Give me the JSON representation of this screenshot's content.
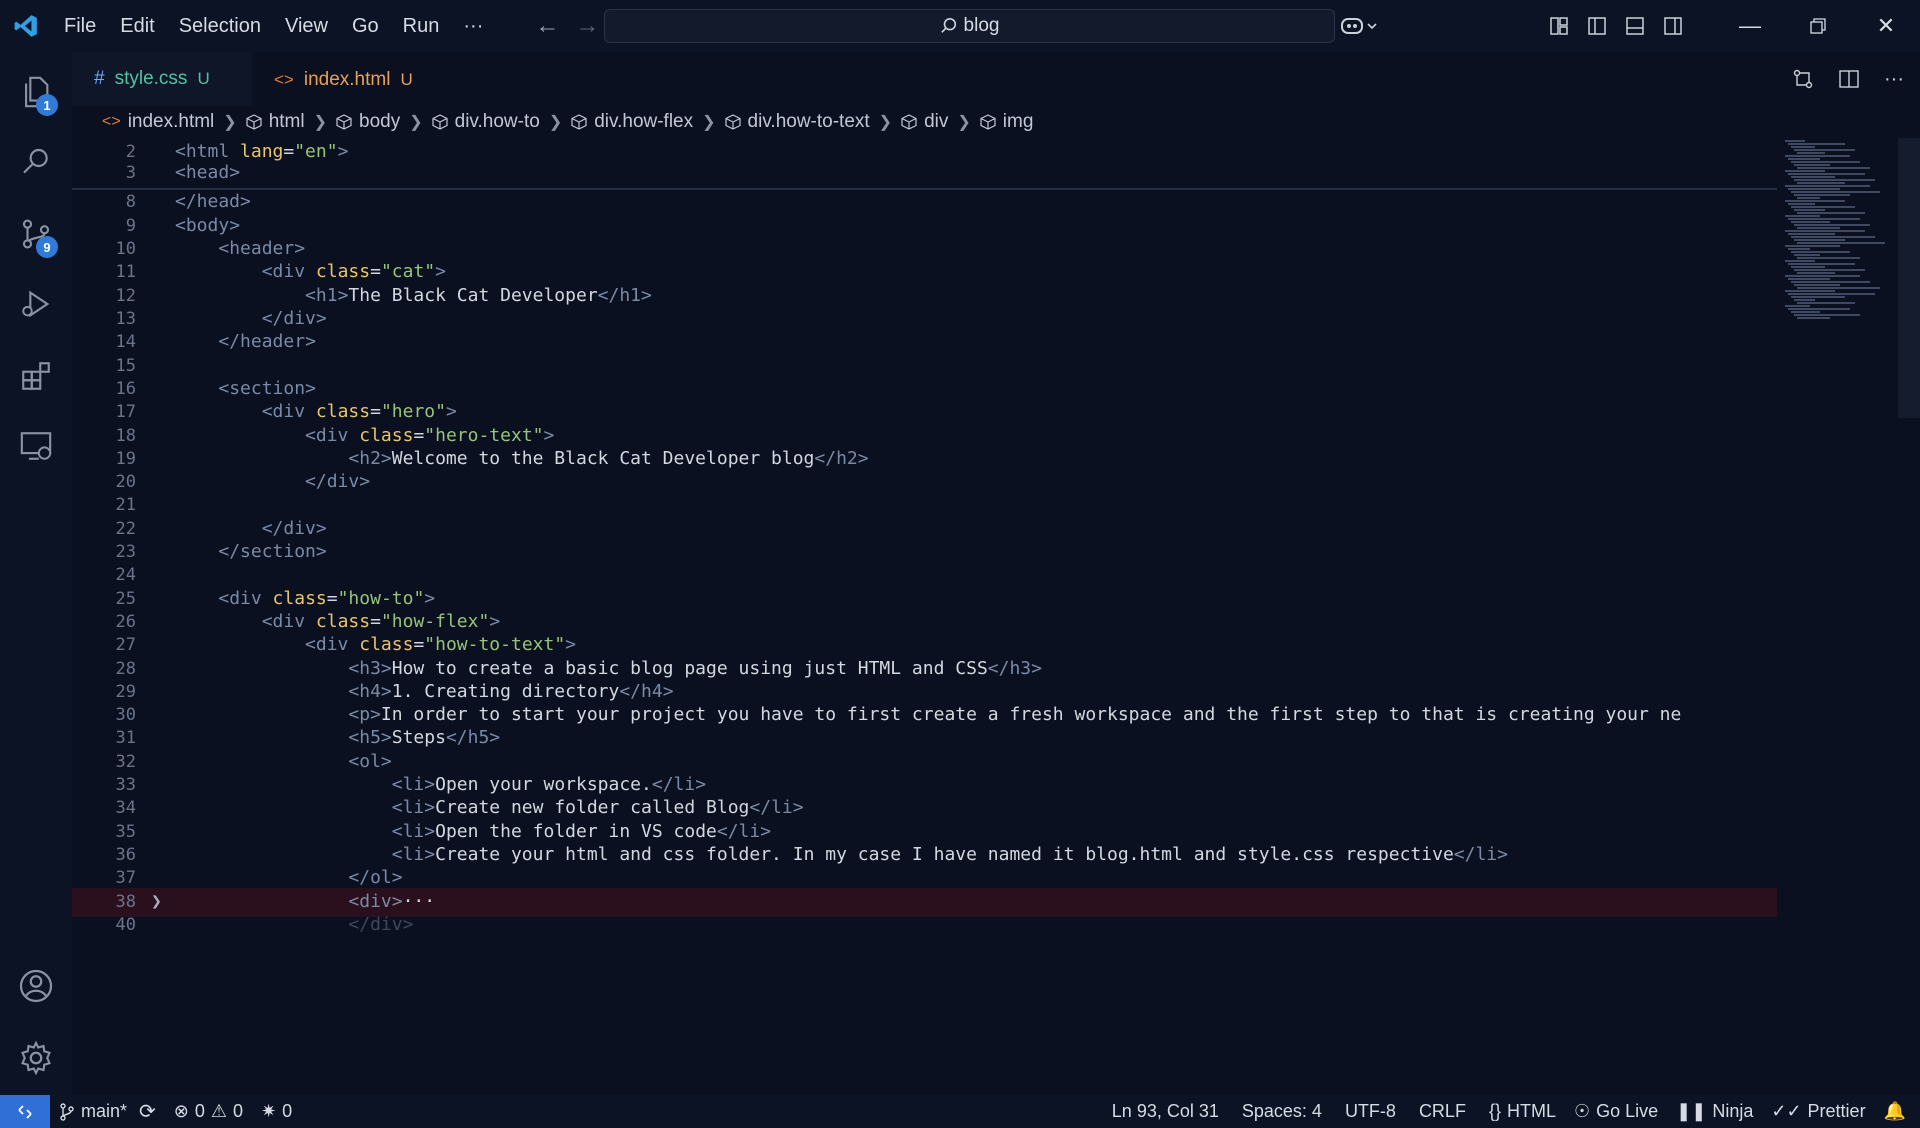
{
  "menu": [
    "File",
    "Edit",
    "Selection",
    "View",
    "Go",
    "Run",
    "···"
  ],
  "search": {
    "text": "blog"
  },
  "activity_badges": {
    "explorer": "1",
    "scm": "9"
  },
  "tabs": [
    {
      "icon": "#",
      "label": "style.css",
      "status": "U"
    },
    {
      "icon": "<>",
      "label": "index.html",
      "status": "U"
    }
  ],
  "breadcrumb": [
    "index.html",
    "html",
    "body",
    "div.how-to",
    "div.how-flex",
    "div.how-to-text",
    "div",
    "img"
  ],
  "code_lines": [
    {
      "n": "2",
      "text": "<html lang=\"en\">"
    },
    {
      "n": "3",
      "text": "<head>"
    },
    {
      "n": "8",
      "text": "</head>"
    },
    {
      "n": "9",
      "text": "<body>"
    },
    {
      "n": "10",
      "text": "    <header>"
    },
    {
      "n": "11",
      "text": "        <div class=\"cat\">"
    },
    {
      "n": "12",
      "text": "            <h1>The Black Cat Developer</h1>"
    },
    {
      "n": "13",
      "text": "        </div>"
    },
    {
      "n": "14",
      "text": "    </header>"
    },
    {
      "n": "15",
      "text": ""
    },
    {
      "n": "16",
      "text": "    <section>"
    },
    {
      "n": "17",
      "text": "        <div class=\"hero\">"
    },
    {
      "n": "18",
      "text": "            <div class=\"hero-text\">"
    },
    {
      "n": "19",
      "text": "                <h2>Welcome to the Black Cat Developer blog</h2>"
    },
    {
      "n": "20",
      "text": "            </div>"
    },
    {
      "n": "21",
      "text": ""
    },
    {
      "n": "22",
      "text": "        </div>"
    },
    {
      "n": "23",
      "text": "    </section>"
    },
    {
      "n": "24",
      "text": ""
    },
    {
      "n": "25",
      "text": "    <div class=\"how-to\">"
    },
    {
      "n": "26",
      "text": "        <div class=\"how-flex\">"
    },
    {
      "n": "27",
      "text": "            <div class=\"how-to-text\">"
    },
    {
      "n": "28",
      "text": "                <h3>How to create a basic blog page using just HTML and CSS</h3>"
    },
    {
      "n": "29",
      "text": "                <h4>1. Creating directory</h4>"
    },
    {
      "n": "30",
      "text": "                <p>In order to start your project you have to first create a fresh workspace and the first step to that is creating your ne"
    },
    {
      "n": "31",
      "text": "                <h5>Steps</h5>"
    },
    {
      "n": "32",
      "text": "                <ol>"
    },
    {
      "n": "33",
      "text": "                    <li>Open your workspace.</li>"
    },
    {
      "n": "34",
      "text": "                    <li>Create new folder called Blog</li>"
    },
    {
      "n": "35",
      "text": "                    <li>Open the folder in VS code</li>"
    },
    {
      "n": "36",
      "text": "                    <li>Create your html and css folder. In my case I have named it blog.html and style.css respective</li>"
    },
    {
      "n": "37",
      "text": "                </ol>"
    },
    {
      "n": "38",
      "text": "                <div>···"
    },
    {
      "n": "40",
      "text": "                </div>"
    }
  ],
  "status": {
    "branch": "main*",
    "errors": "0",
    "warnings": "0",
    "ports": "0",
    "position": "Ln 93, Col 31",
    "spaces": "Spaces: 4",
    "encoding": "UTF-8",
    "eol": "CRLF",
    "language": "HTML",
    "golive": "Go Live",
    "ninja": "Ninja",
    "prettier": "Prettier"
  },
  "colors": {
    "accent": "#2f7bd6",
    "tag": "#7a8aa6",
    "attr": "#e9c46a",
    "string": "#98c379",
    "highlight_line": "#2a0f1c"
  }
}
